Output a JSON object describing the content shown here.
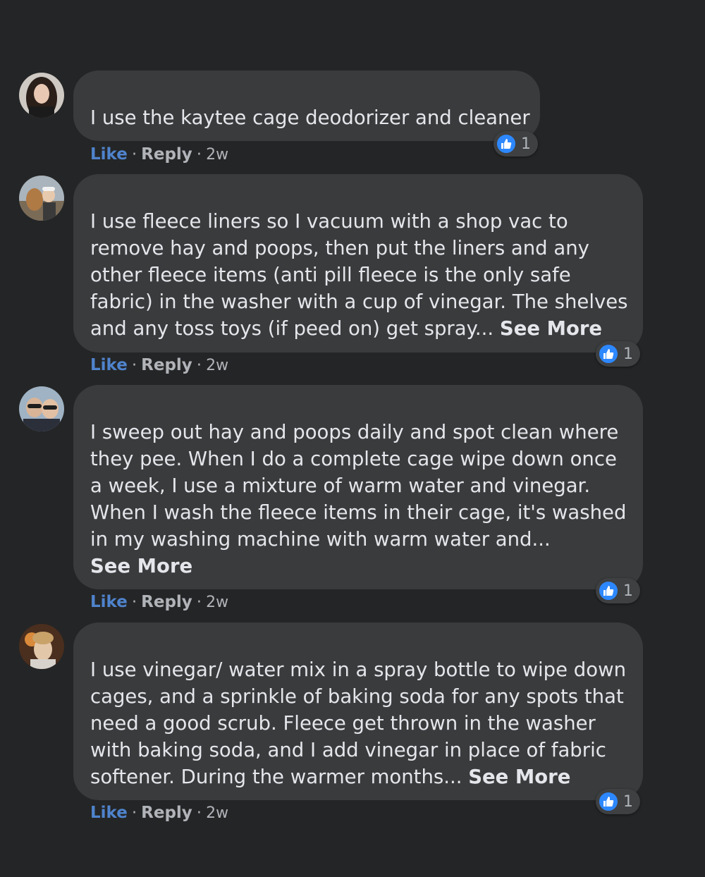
{
  "comments": [
    {
      "text_lines": [
        "I use the kaytee cage deodorizer and cleaner"
      ],
      "see_more": "",
      "like_label": "Like",
      "reply_label": "Reply",
      "time": "2w",
      "reaction_count": "1"
    },
    {
      "text_lines": [
        "I use fleece liners so I vacuum with a shop vac to",
        "remove hay and poops, then put the liners and any",
        "other fleece items (anti pill fleece is the only safe",
        "fabric) in the washer with a cup of vinegar. The shelves",
        "and any toss toys (if peed on) get spray..."
      ],
      "see_more": "See More",
      "like_label": "Like",
      "reply_label": "Reply",
      "time": "2w",
      "reaction_count": "1"
    },
    {
      "text_lines": [
        "I sweep out hay and poops daily and spot clean where",
        "they pee. When I do a complete cage wipe down once",
        "a week, I use a mixture of warm water and vinegar.",
        "When I wash the fleece items in their cage, it's washed",
        "in my washing machine with warm water and..."
      ],
      "see_more": "See More",
      "like_label": "Like",
      "reply_label": "Reply",
      "time": "2w",
      "reaction_count": "1"
    },
    {
      "text_lines": [
        "I use vinegar/ water mix in a spray bottle to wipe down",
        "cages, and a sprinkle of baking soda for any spots that",
        "need a good scrub. Fleece get thrown in the washer",
        "with baking soda, and I add vinegar in place of fabric",
        "softener. During the warmer months..."
      ],
      "see_more": "See More",
      "like_label": "Like",
      "reply_label": "Reply",
      "time": "2w",
      "reaction_count": "1"
    }
  ],
  "colors": {
    "background": "#242526",
    "bubble": "#3a3b3c",
    "text": "#e4e6eb",
    "like_link": "#4f83cc",
    "meta": "#b0b3b8",
    "like_reaction": "#2d88ff"
  },
  "icons": {
    "reaction": "thumbs-up-icon"
  }
}
